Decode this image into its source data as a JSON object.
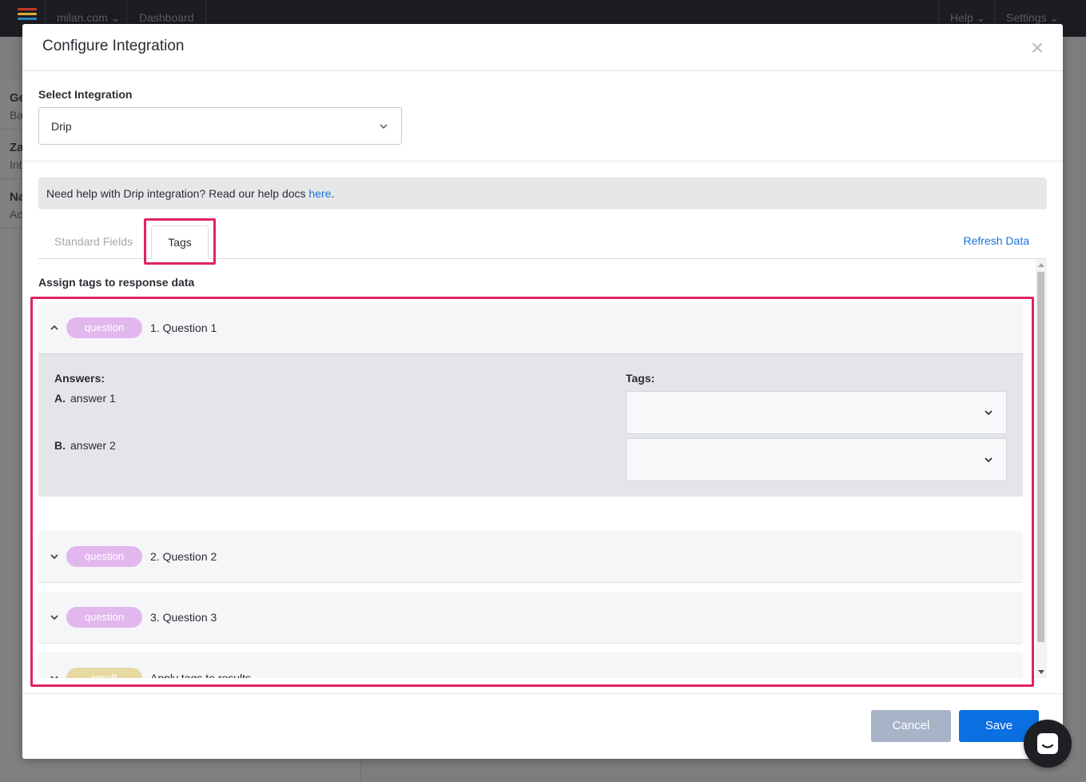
{
  "background": {
    "topbar": {
      "site": "milan.com",
      "dashboard": "Dashboard",
      "help": "Help",
      "settings": "Settings"
    },
    "rows": [
      {
        "title": "Ge",
        "sub": "Ba"
      },
      {
        "title": "Za",
        "sub": "Int"
      },
      {
        "title": "Na",
        "sub": "Ac"
      }
    ]
  },
  "modal": {
    "title": "Configure Integration",
    "close_icon": "close-icon",
    "select_label": "Select Integration",
    "select_value": "Drip",
    "help": {
      "text": "Need help with Drip integration? Read our help docs ",
      "link": "here",
      "end": "."
    },
    "tabs": [
      {
        "label": "Standard Fields",
        "active": false
      },
      {
        "label": "Tags",
        "active": true
      }
    ],
    "refresh": "Refresh Data",
    "assign_label": "Assign tags to response data",
    "items": [
      {
        "pill": "question",
        "title": "1. Question 1",
        "expanded": true,
        "answers_label": "Answers:",
        "tags_label": "Tags:",
        "answers": [
          {
            "letter": "A.",
            "text": "answer 1",
            "tag_value": ""
          },
          {
            "letter": "B.",
            "text": "answer 2",
            "tag_value": ""
          }
        ]
      },
      {
        "pill": "question",
        "title": "2. Question 2",
        "expanded": false
      },
      {
        "pill": "question",
        "title": "3. Question 3",
        "expanded": false
      },
      {
        "pill": "result",
        "title": "Apply tags to results",
        "expanded": false
      }
    ],
    "buttons": {
      "cancel": "Cancel",
      "save": "Save"
    }
  },
  "colors": {
    "accent": "#0a6fe0",
    "highlight": "#e0245e",
    "question_pill": "#e2b7ee",
    "result_pill": "#e8d9a3"
  },
  "chat_icon": "chat-icon"
}
